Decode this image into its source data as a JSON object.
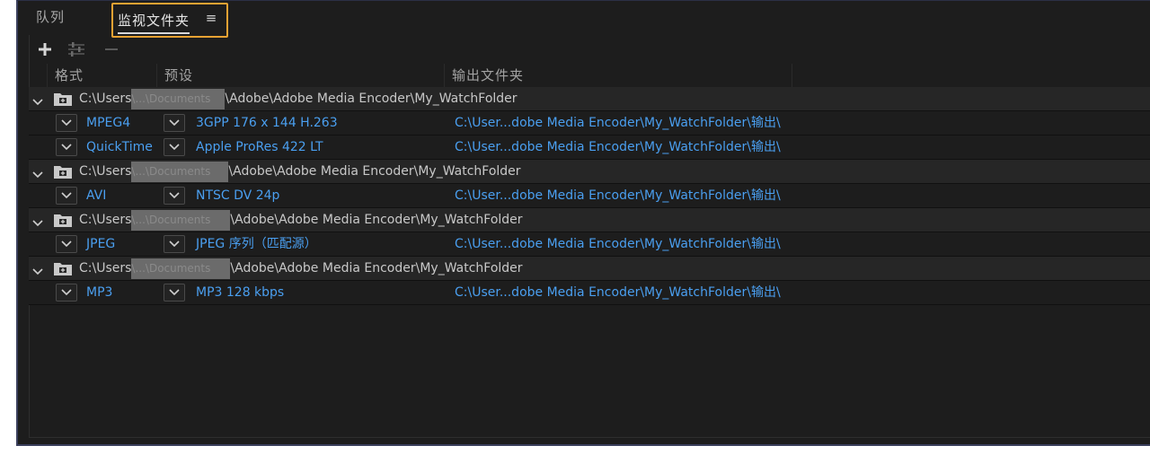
{
  "tabs": {
    "queue": "队列",
    "watch_folders": "监视文件夹",
    "menu_glyph": "≡"
  },
  "toolbar": {
    "add_icon": "plus-icon",
    "settings_icon": "sliders-icon",
    "remove_icon": "minus-icon"
  },
  "columns": {
    "format": "格式",
    "preset": "预设",
    "output": "输出文件夹"
  },
  "colors": {
    "accent_tab_border": "#e8a233",
    "link_blue": "#4a9ff0",
    "panel_bg": "#1d1d1d",
    "folder_row_bg": "#262626"
  },
  "groups": [
    {
      "path_prefix": "C:\\Users",
      "path_redacted": "\\...\\Documents",
      "path_suffix": "\\Adobe\\Adobe Media Encoder\\My_WatchFolder",
      "items": [
        {
          "format": "MPEG4",
          "preset": "3GPP 176 x 144 H.263",
          "output": "C:\\User...dobe Media Encoder\\My_WatchFolder\\输出\\"
        },
        {
          "format": "QuickTime",
          "preset": "Apple ProRes 422 LT",
          "output": "C:\\User...dobe Media Encoder\\My_WatchFolder\\输出\\"
        }
      ]
    },
    {
      "path_prefix": "C:\\Users",
      "path_redacted": "\\...\\Documents",
      "path_suffix": "\\Adobe\\Adobe Media Encoder\\My_WatchFolder",
      "items": [
        {
          "format": "AVI",
          "preset": "NTSC DV 24p",
          "output": "C:\\User...dobe Media Encoder\\My_WatchFolder\\输出\\"
        }
      ]
    },
    {
      "path_prefix": "C:\\Users",
      "path_redacted": "\\...\\Documents",
      "path_suffix": "\\Adobe\\Adobe Media Encoder\\My_WatchFolder",
      "items": [
        {
          "format": "JPEG",
          "preset": "JPEG 序列（匹配源）",
          "output": "C:\\User...dobe Media Encoder\\My_WatchFolder\\输出\\"
        }
      ]
    },
    {
      "path_prefix": "C:\\Users",
      "path_redacted": "\\...\\Documents",
      "path_suffix": "\\Adobe\\Adobe Media Encoder\\My_WatchFolder",
      "items": [
        {
          "format": "MP3",
          "preset": "MP3 128 kbps",
          "output": "C:\\User...dobe Media Encoder\\My_WatchFolder\\输出\\"
        }
      ]
    }
  ]
}
